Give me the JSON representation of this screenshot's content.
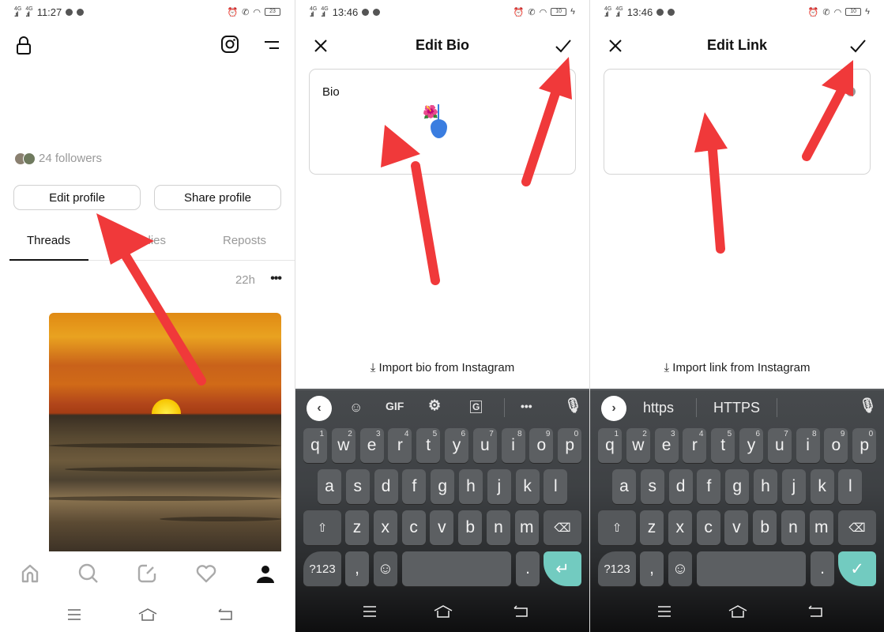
{
  "panels": {
    "profile": {
      "status": {
        "time": "11:27",
        "battery": "23"
      },
      "followers_text": "24 followers",
      "buttons": {
        "edit_profile": "Edit profile",
        "share_profile": "Share profile"
      },
      "tabs": [
        {
          "label": "Threads",
          "active": true
        },
        {
          "label": "Replies",
          "active": false
        },
        {
          "label": "Reposts",
          "active": false
        }
      ],
      "post": {
        "time": "22h",
        "more": "•••"
      },
      "bottom_nav": [
        "home",
        "search",
        "compose",
        "activity",
        "profile"
      ]
    },
    "edit_bio": {
      "status": {
        "time": "13:46",
        "battery": "10"
      },
      "title": "Edit Bio",
      "field_label": "Bio",
      "field_value": "🌺",
      "import_label": "Import bio from Instagram",
      "toolbar": {
        "gif": "GIF"
      }
    },
    "edit_link": {
      "status": {
        "time": "13:46",
        "battery": "10"
      },
      "title": "Edit Link",
      "field_value": "",
      "import_label": "Import link from Instagram",
      "suggestions": [
        "https",
        "HTTPS"
      ]
    }
  },
  "keyboard": {
    "row1": [
      {
        "k": "q",
        "n": "1"
      },
      {
        "k": "w",
        "n": "2"
      },
      {
        "k": "e",
        "n": "3"
      },
      {
        "k": "r",
        "n": "4"
      },
      {
        "k": "t",
        "n": "5"
      },
      {
        "k": "y",
        "n": "6"
      },
      {
        "k": "u",
        "n": "7"
      },
      {
        "k": "i",
        "n": "8"
      },
      {
        "k": "o",
        "n": "9"
      },
      {
        "k": "p",
        "n": "0"
      }
    ],
    "row2": [
      "a",
      "s",
      "d",
      "f",
      "g",
      "h",
      "j",
      "k",
      "l"
    ],
    "row3": [
      "z",
      "x",
      "c",
      "v",
      "b",
      "n",
      "m"
    ],
    "symbols_label": "?123",
    "comma": ",",
    "period": "."
  },
  "colors": {
    "arrow": "#f0393a",
    "enter_key": "#72cbc0",
    "cursor": "#3a7de0"
  }
}
